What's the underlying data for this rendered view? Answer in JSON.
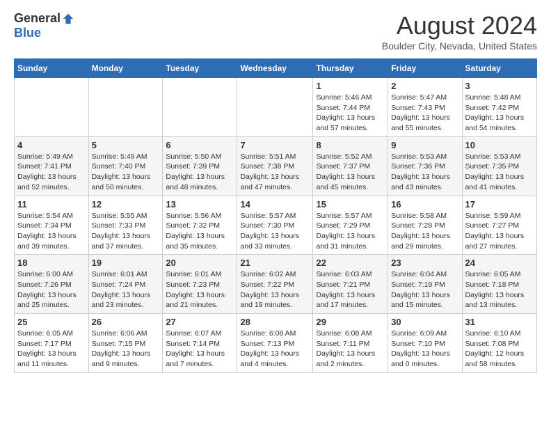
{
  "header": {
    "logo_general": "General",
    "logo_blue": "Blue",
    "month_title": "August 2024",
    "location": "Boulder City, Nevada, United States"
  },
  "columns": [
    "Sunday",
    "Monday",
    "Tuesday",
    "Wednesday",
    "Thursday",
    "Friday",
    "Saturday"
  ],
  "weeks": [
    [
      {
        "day": "",
        "info": ""
      },
      {
        "day": "",
        "info": ""
      },
      {
        "day": "",
        "info": ""
      },
      {
        "day": "",
        "info": ""
      },
      {
        "day": "1",
        "info": "Sunrise: 5:46 AM\nSunset: 7:44 PM\nDaylight: 13 hours\nand 57 minutes."
      },
      {
        "day": "2",
        "info": "Sunrise: 5:47 AM\nSunset: 7:43 PM\nDaylight: 13 hours\nand 55 minutes."
      },
      {
        "day": "3",
        "info": "Sunrise: 5:48 AM\nSunset: 7:42 PM\nDaylight: 13 hours\nand 54 minutes."
      }
    ],
    [
      {
        "day": "4",
        "info": "Sunrise: 5:49 AM\nSunset: 7:41 PM\nDaylight: 13 hours\nand 52 minutes."
      },
      {
        "day": "5",
        "info": "Sunrise: 5:49 AM\nSunset: 7:40 PM\nDaylight: 13 hours\nand 50 minutes."
      },
      {
        "day": "6",
        "info": "Sunrise: 5:50 AM\nSunset: 7:39 PM\nDaylight: 13 hours\nand 48 minutes."
      },
      {
        "day": "7",
        "info": "Sunrise: 5:51 AM\nSunset: 7:38 PM\nDaylight: 13 hours\nand 47 minutes."
      },
      {
        "day": "8",
        "info": "Sunrise: 5:52 AM\nSunset: 7:37 PM\nDaylight: 13 hours\nand 45 minutes."
      },
      {
        "day": "9",
        "info": "Sunrise: 5:53 AM\nSunset: 7:36 PM\nDaylight: 13 hours\nand 43 minutes."
      },
      {
        "day": "10",
        "info": "Sunrise: 5:53 AM\nSunset: 7:35 PM\nDaylight: 13 hours\nand 41 minutes."
      }
    ],
    [
      {
        "day": "11",
        "info": "Sunrise: 5:54 AM\nSunset: 7:34 PM\nDaylight: 13 hours\nand 39 minutes."
      },
      {
        "day": "12",
        "info": "Sunrise: 5:55 AM\nSunset: 7:33 PM\nDaylight: 13 hours\nand 37 minutes."
      },
      {
        "day": "13",
        "info": "Sunrise: 5:56 AM\nSunset: 7:32 PM\nDaylight: 13 hours\nand 35 minutes."
      },
      {
        "day": "14",
        "info": "Sunrise: 5:57 AM\nSunset: 7:30 PM\nDaylight: 13 hours\nand 33 minutes."
      },
      {
        "day": "15",
        "info": "Sunrise: 5:57 AM\nSunset: 7:29 PM\nDaylight: 13 hours\nand 31 minutes."
      },
      {
        "day": "16",
        "info": "Sunrise: 5:58 AM\nSunset: 7:28 PM\nDaylight: 13 hours\nand 29 minutes."
      },
      {
        "day": "17",
        "info": "Sunrise: 5:59 AM\nSunset: 7:27 PM\nDaylight: 13 hours\nand 27 minutes."
      }
    ],
    [
      {
        "day": "18",
        "info": "Sunrise: 6:00 AM\nSunset: 7:26 PM\nDaylight: 13 hours\nand 25 minutes."
      },
      {
        "day": "19",
        "info": "Sunrise: 6:01 AM\nSunset: 7:24 PM\nDaylight: 13 hours\nand 23 minutes."
      },
      {
        "day": "20",
        "info": "Sunrise: 6:01 AM\nSunset: 7:23 PM\nDaylight: 13 hours\nand 21 minutes."
      },
      {
        "day": "21",
        "info": "Sunrise: 6:02 AM\nSunset: 7:22 PM\nDaylight: 13 hours\nand 19 minutes."
      },
      {
        "day": "22",
        "info": "Sunrise: 6:03 AM\nSunset: 7:21 PM\nDaylight: 13 hours\nand 17 minutes."
      },
      {
        "day": "23",
        "info": "Sunrise: 6:04 AM\nSunset: 7:19 PM\nDaylight: 13 hours\nand 15 minutes."
      },
      {
        "day": "24",
        "info": "Sunrise: 6:05 AM\nSunset: 7:18 PM\nDaylight: 13 hours\nand 13 minutes."
      }
    ],
    [
      {
        "day": "25",
        "info": "Sunrise: 6:05 AM\nSunset: 7:17 PM\nDaylight: 13 hours\nand 11 minutes."
      },
      {
        "day": "26",
        "info": "Sunrise: 6:06 AM\nSunset: 7:15 PM\nDaylight: 13 hours\nand 9 minutes."
      },
      {
        "day": "27",
        "info": "Sunrise: 6:07 AM\nSunset: 7:14 PM\nDaylight: 13 hours\nand 7 minutes."
      },
      {
        "day": "28",
        "info": "Sunrise: 6:08 AM\nSunset: 7:13 PM\nDaylight: 13 hours\nand 4 minutes."
      },
      {
        "day": "29",
        "info": "Sunrise: 6:08 AM\nSunset: 7:11 PM\nDaylight: 13 hours\nand 2 minutes."
      },
      {
        "day": "30",
        "info": "Sunrise: 6:09 AM\nSunset: 7:10 PM\nDaylight: 13 hours\nand 0 minutes."
      },
      {
        "day": "31",
        "info": "Sunrise: 6:10 AM\nSunset: 7:08 PM\nDaylight: 12 hours\nand 58 minutes."
      }
    ]
  ]
}
